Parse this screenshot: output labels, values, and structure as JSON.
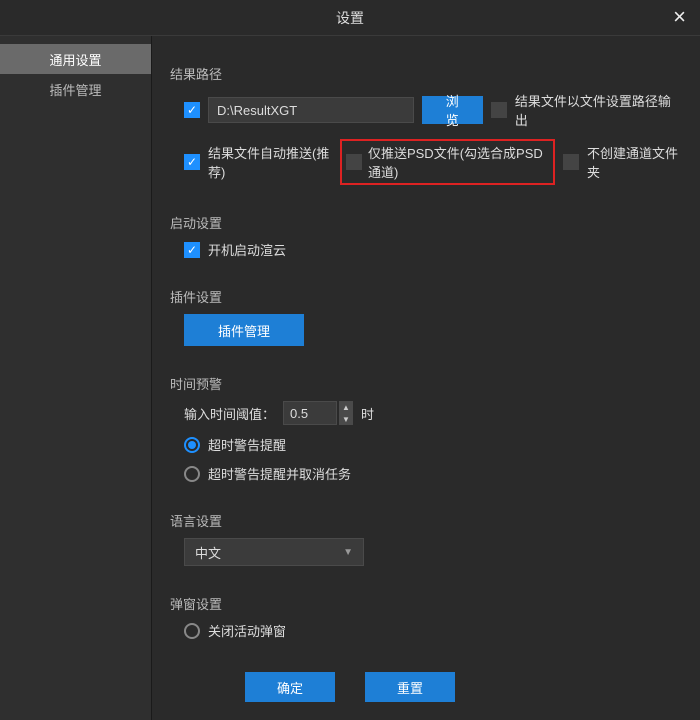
{
  "titlebar": {
    "title": "设置"
  },
  "sidebar": {
    "items": [
      {
        "label": "通用设置"
      },
      {
        "label": "插件管理"
      }
    ]
  },
  "result_path": {
    "section_label": "结果路径",
    "path_value": "D:\\ResultXGT",
    "browse_label": "浏览",
    "output_by_setting_path_label": "结果文件以文件设置路径输出",
    "auto_push_label": "结果文件自动推送(推荐)",
    "only_psd_label": "仅推送PSD文件(勾选合成PSD通道)",
    "no_channel_folder_label": "不创建通道文件夹"
  },
  "startup": {
    "section_label": "启动设置",
    "auto_start_label": "开机启动渲云"
  },
  "plugin": {
    "section_label": "插件设置",
    "manage_label": "插件管理"
  },
  "time_warn": {
    "section_label": "时间预警",
    "threshold_label": "输入时间阈值：",
    "threshold_value": "0.5",
    "unit": "时",
    "opt1_label": "超时警告提醒",
    "opt2_label": "超时警告提醒并取消任务"
  },
  "language": {
    "section_label": "语言设置",
    "selected": "中文"
  },
  "popup": {
    "section_label": "弹窗设置",
    "close_active_label": "关闭活动弹窗"
  },
  "footer": {
    "ok_label": "确定",
    "reset_label": "重置"
  }
}
